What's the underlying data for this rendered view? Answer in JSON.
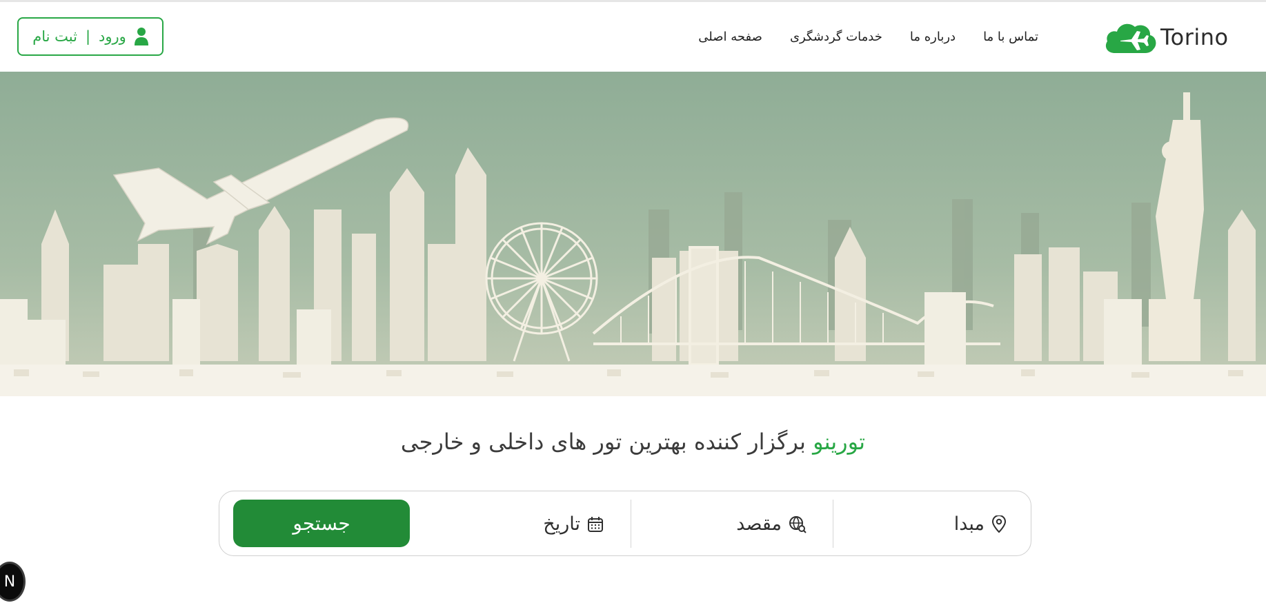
{
  "brand": {
    "name": "Torino",
    "logo_color": "#28a745"
  },
  "nav": {
    "items": [
      {
        "label": "صفحه اصلی"
      },
      {
        "label": "خدمات گردشگری"
      },
      {
        "label": "درباره ما"
      },
      {
        "label": "تماس با ما"
      }
    ]
  },
  "auth": {
    "login": "ورود",
    "separator": "|",
    "register": "ثبت نام",
    "icon": "user-icon"
  },
  "hero": {
    "image": "city-skyline-with-airplane",
    "sky_color": "#a3b8a3"
  },
  "headline": {
    "brand": "تورینو",
    "rest": "برگزار کننده بهترین تور های داخلی و خارجی"
  },
  "search": {
    "origin": {
      "label": "مبدا",
      "icon": "location-pin-icon"
    },
    "destination": {
      "label": "مقصد",
      "icon": "globe-search-icon"
    },
    "date": {
      "label": "تاریخ",
      "icon": "calendar-icon"
    },
    "submit": "جستجو",
    "accent": "#228b37"
  },
  "devtools": {
    "badge": "N"
  }
}
